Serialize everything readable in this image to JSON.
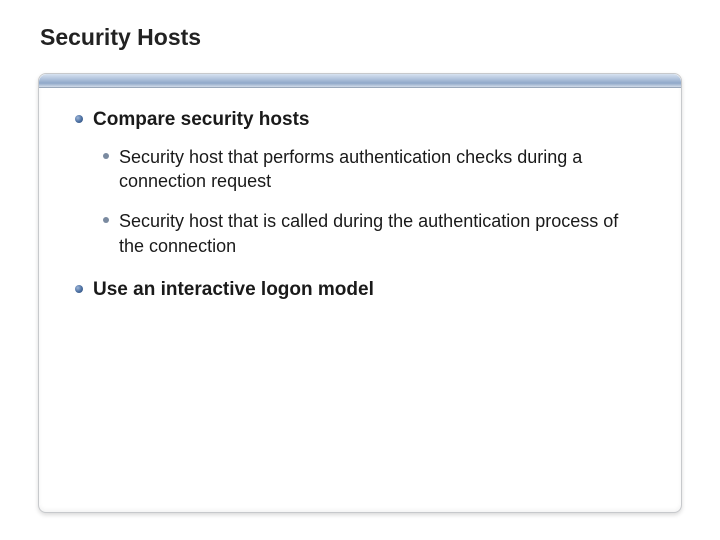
{
  "title": "Security Hosts",
  "bullets": {
    "b1": "Compare security hosts",
    "b1_sub1": "Security host that performs authentication checks during a connection request",
    "b1_sub2": "Security host that is called during the authentication process of the connection",
    "b2": "Use an interactive logon model"
  }
}
